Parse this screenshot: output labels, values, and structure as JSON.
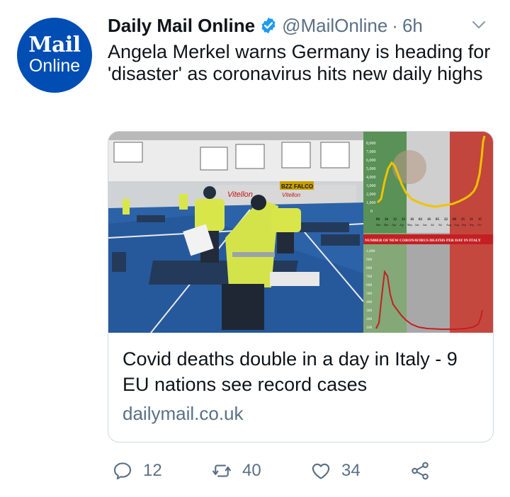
{
  "account": {
    "avatar_line1": "Mail",
    "avatar_line2": "Online",
    "display_name": "Daily Mail Online",
    "handle": "@MailOnline",
    "separator": "·",
    "time": "6h"
  },
  "tweet": {
    "text": "Angela Merkel warns Germany is heading for 'disaster' as coronavirus hits new daily highs"
  },
  "card": {
    "title": "Covid deaths double in a day in Italy - 9 EU nations see record cases",
    "domain": "dailymail.co.uk",
    "image": {
      "gym_signs": [
        "BZZ",
        "FALCO",
        "Vitellon",
        "Vitellon"
      ],
      "chart_top": {
        "y_ticks": [
          "8,000",
          "7,000",
          "6,000",
          "5,000",
          "4,000",
          "3,000",
          "2,000",
          "1,000",
          "0"
        ],
        "x_days": [
          "06",
          "26",
          "12",
          "23",
          "16",
          "02",
          "16",
          "05",
          "22",
          "08",
          "25",
          "11",
          "15"
        ],
        "x_months": [
          "Mar",
          "Mar",
          "Apr",
          "Apr",
          "May",
          "Jun",
          "Jun",
          "Jul",
          "Jul",
          "Aug",
          "Aug",
          "Sep",
          "Sep",
          "Oct"
        ]
      },
      "chart_bottom": {
        "title": "NUMBER OF NEW CORONAVIRUS DEATHS PER DAY IN ITALY",
        "y_ticks": [
          "1,000",
          "900",
          "800",
          "700",
          "600",
          "500",
          "400",
          "300",
          "200",
          "100"
        ]
      }
    }
  },
  "actions": {
    "reply_count": "12",
    "retweet_count": "40",
    "like_count": "34"
  },
  "colors": {
    "avatar_bg": "#004db3",
    "verified": "#1d9bf0",
    "secondary_text": "#5b7083",
    "border": "#cfd9de"
  }
}
